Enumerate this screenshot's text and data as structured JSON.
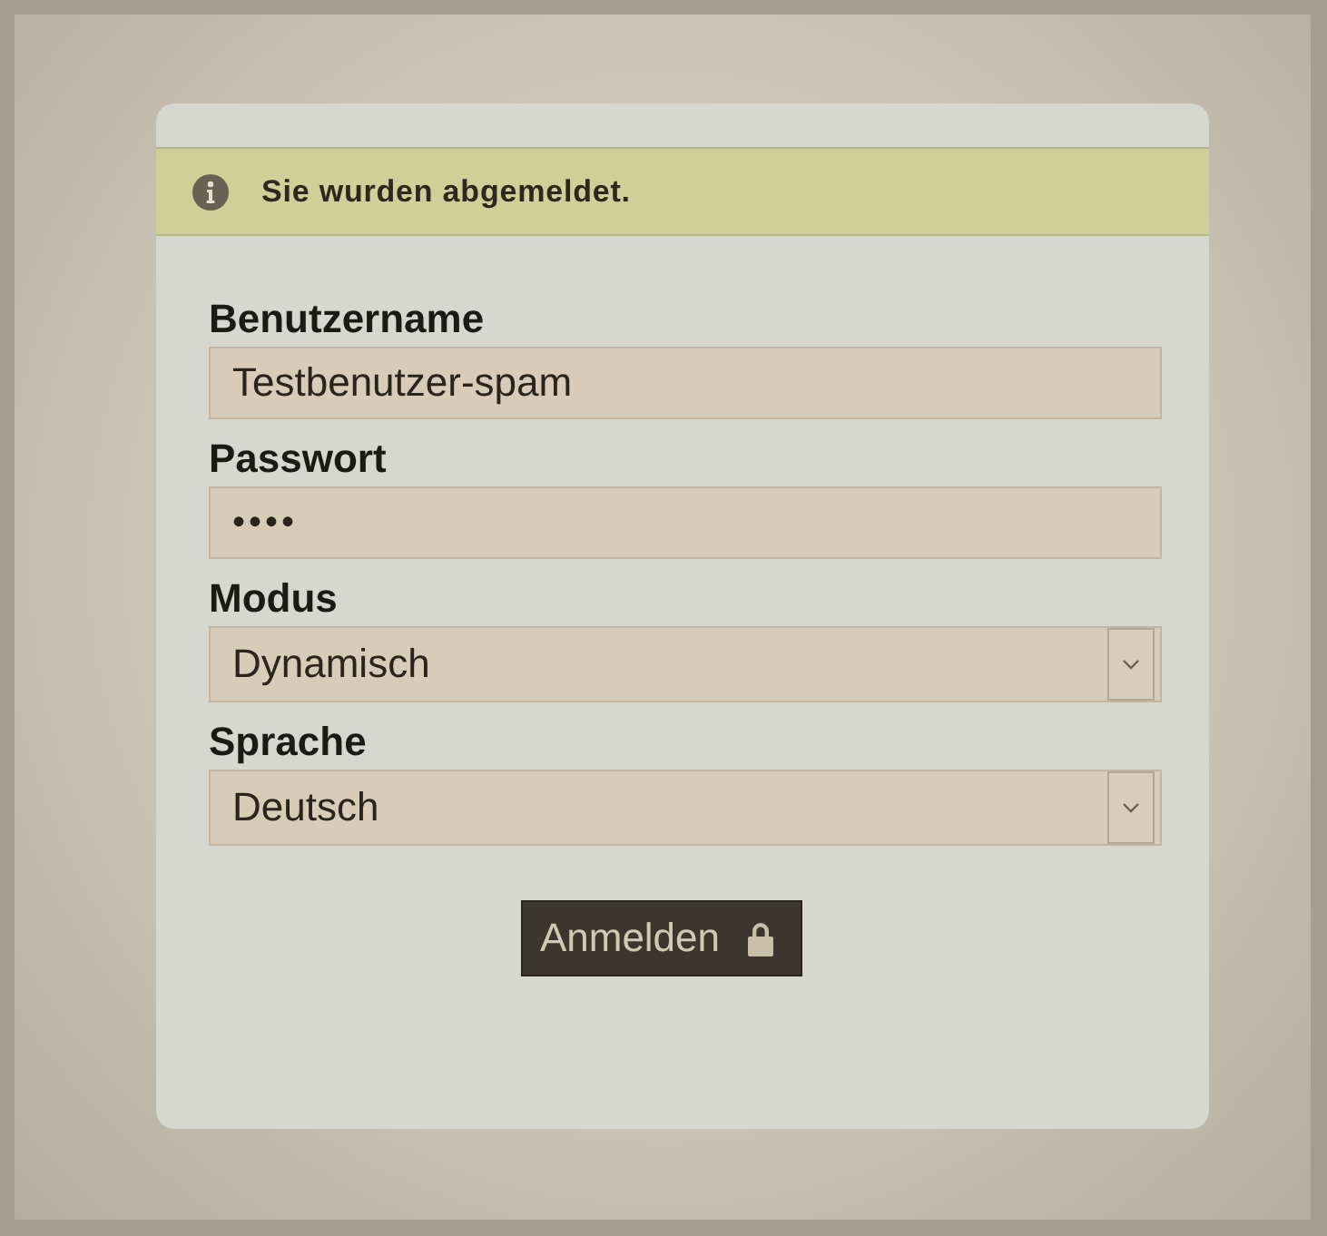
{
  "notice": {
    "text": "Sie wurden abgemeldet."
  },
  "fields": [
    {
      "kind": "text",
      "label": "Benutzername",
      "value": "Testbenutzer-spam"
    },
    {
      "kind": "password",
      "label": "Passwort",
      "value": "••••"
    },
    {
      "kind": "select",
      "label": "Modus",
      "value": "Dynamisch"
    },
    {
      "kind": "select",
      "label": "Sprache",
      "value": "Deutsch"
    }
  ],
  "button": {
    "label": "Anmelden"
  }
}
